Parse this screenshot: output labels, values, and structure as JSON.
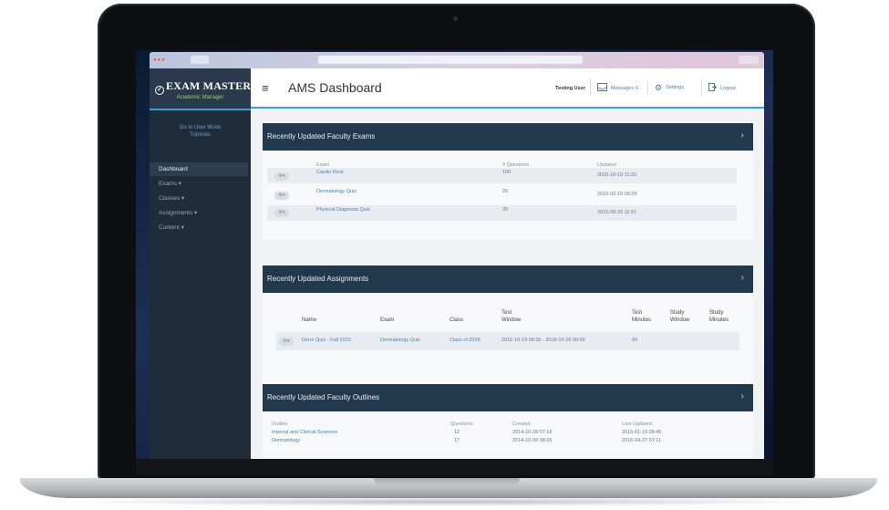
{
  "app": {
    "logo": {
      "name": "EXAM MASTER",
      "tagline": "Academic Manager"
    },
    "page_title": "AMS Dashboard"
  },
  "sidebar": {
    "links": [
      "Go to User Mode",
      "Tutorials"
    ],
    "items": [
      {
        "label": "Dashboard"
      },
      {
        "label": "Exams ▾"
      },
      {
        "label": "Classes ▾"
      },
      {
        "label": "Assignments ▾"
      },
      {
        "label": "Content ▾"
      }
    ]
  },
  "header": {
    "user": "Testing User",
    "messages": "Messages 0",
    "settings": "Settings",
    "logout": "Logout"
  },
  "exams_panel": {
    "title": "Recently Updated Faculty Exams",
    "columns": [
      "Exam",
      "# Questions",
      "Updated"
    ],
    "rows": [
      {
        "exam": "Cardio Final",
        "questions": "100",
        "updated": "2016-10-19 11:29"
      },
      {
        "exam": "Dermatology Quiz",
        "questions": "25",
        "updated": "2016-02-16 06:29"
      },
      {
        "exam": "Physical Diagnosis Quiz",
        "questions": "30",
        "updated": "2015-09-30 11:37"
      }
    ]
  },
  "assignments_panel": {
    "title": "Recently Updated Assignments",
    "columns": {
      "name": "Name",
      "exam": "Exam",
      "class": "Class",
      "test_window": [
        "Test",
        "Window"
      ],
      "test_minutes": [
        "Test",
        "Minutes"
      ],
      "study_window": [
        "Study",
        "Window"
      ],
      "study_minutes": [
        "Study",
        "Minutes"
      ]
    },
    "rows": [
      {
        "name": "Derm Quiz - Fall 2016",
        "exam": "Dermatology Quiz",
        "class": "Class of 2018",
        "window": "2016-10-19 08:35 - 2016-10-20 00:00",
        "minutes": "60"
      }
    ]
  },
  "outlines_panel": {
    "title": "Recently Updated Faculty Outlines",
    "columns": [
      "Outline",
      "Questions",
      "Created",
      "Last Updated"
    ],
    "rows": [
      {
        "outline": "Internal and Clinical Sciences",
        "questions": "12",
        "created": "2014-10-28 07:16",
        "updated": "2015-01-19 08:45"
      },
      {
        "outline": "Dermatology",
        "questions": "17",
        "created": "2014-10-09 08:25",
        "updated": "2016-04-27 07:11"
      }
    ]
  },
  "icons": {
    "gear": "gear-icon",
    "chevron": "chevron-right-icon",
    "menu": "hamburger-icon",
    "messages": "inbox-icon",
    "settings": "gear-icon",
    "logout": "logout-icon"
  },
  "colors": {
    "accent": "#3aa1c9",
    "panel_header": "#22384c",
    "sidebar": "#1f2c3a",
    "link": "#4a7fb5"
  }
}
